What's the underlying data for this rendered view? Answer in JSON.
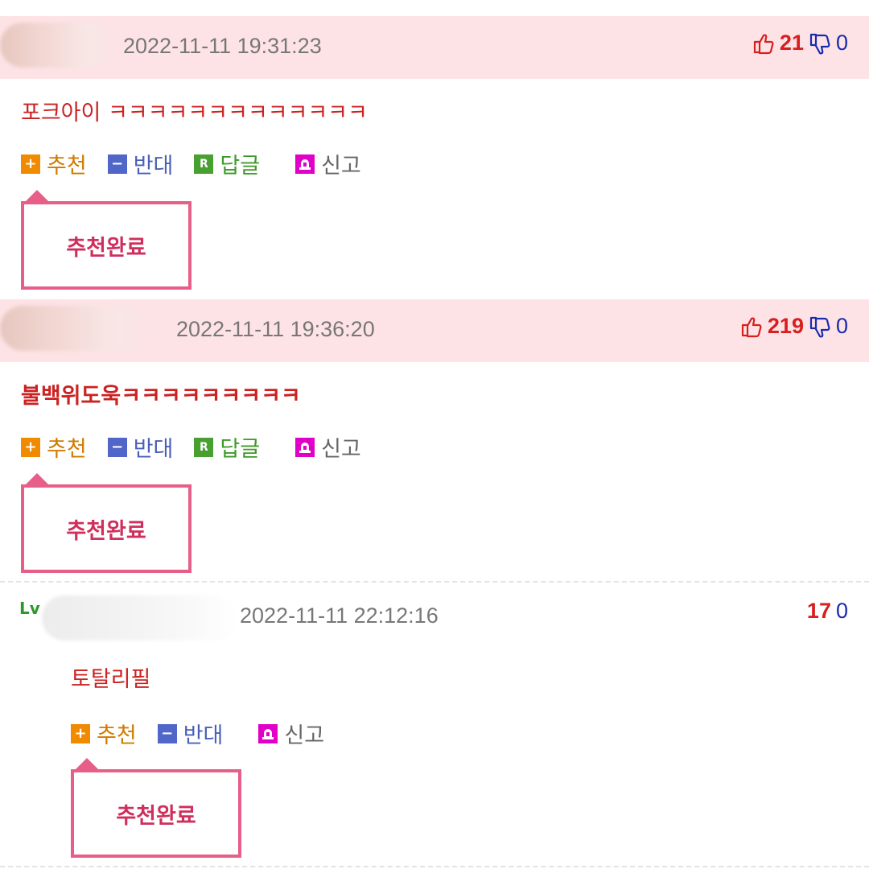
{
  "comments": [
    {
      "date": "2022-11-11 19:31:23",
      "up": "21",
      "down": "0",
      "text": "포크아이 ㅋㅋㅋㅋㅋㅋㅋㅋㅋㅋㅋㅋㅋ",
      "recommend_label": "추천",
      "oppose_label": "반대",
      "reply_label": "답글",
      "report_label": "신고",
      "done_label": "추천완료"
    },
    {
      "date": "2022-11-11 19:36:20",
      "up": "219",
      "down": "0",
      "text": "불백위도욱ㅋㅋㅋㅋㅋㅋㅋㅋㅋ",
      "recommend_label": "추천",
      "oppose_label": "반대",
      "reply_label": "답글",
      "report_label": "신고",
      "done_label": "추천완료"
    },
    {
      "level_icon": "Lv",
      "date": "2022-11-11 22:12:16",
      "up": "17",
      "down": "0",
      "text": "토탈리필",
      "recommend_label": "추천",
      "oppose_label": "반대",
      "report_label": "신고",
      "done_label": "추천완료"
    }
  ],
  "colors": {
    "best_bg": "#fde3e6",
    "up_red": "#d81e1e",
    "down_blue": "#1a2cae",
    "popup_border": "#e75f88"
  },
  "icons": {
    "up": "thumbs-up-icon",
    "down": "thumbs-down-icon",
    "recommend": "plus-icon",
    "oppose": "minus-icon",
    "reply": "reply-r-icon",
    "report": "siren-icon"
  }
}
